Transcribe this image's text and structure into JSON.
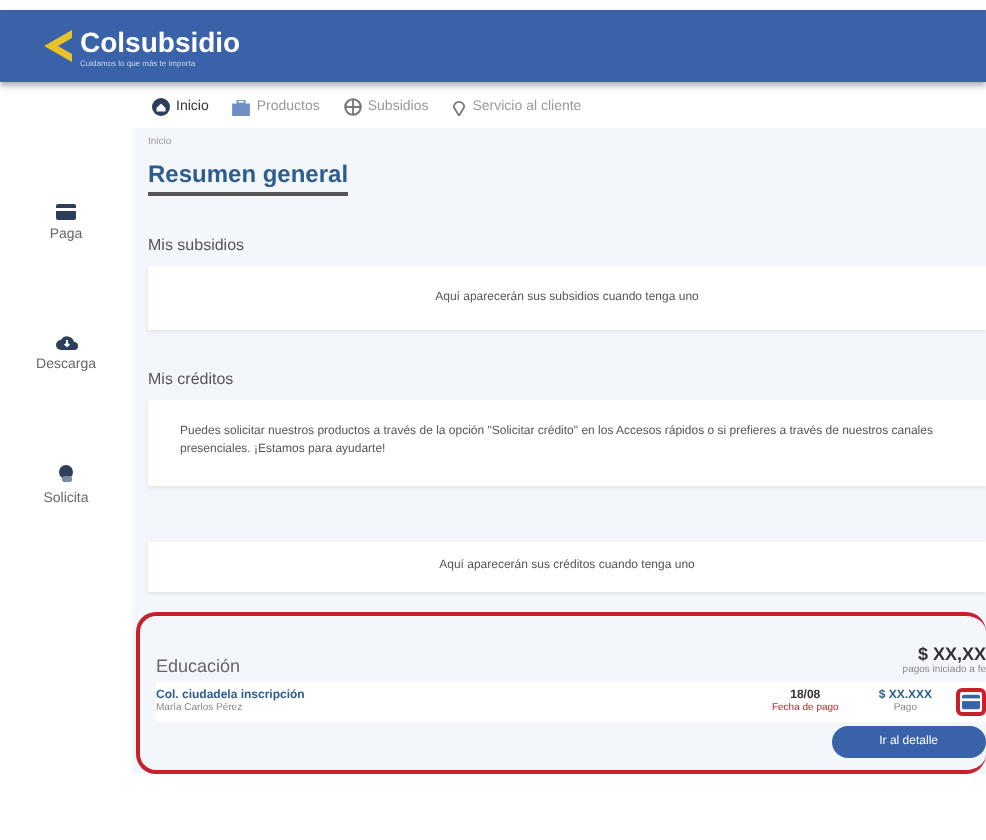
{
  "header": {
    "brand": "Colsubsidio",
    "tagline": "Cuidamos lo que más te importa"
  },
  "nav": [
    {
      "label": "Inicio",
      "selected": true
    },
    {
      "label": "Productos",
      "selected": false
    },
    {
      "label": "Subsidios",
      "selected": false
    },
    {
      "label": "Servicio al cliente",
      "selected": false
    }
  ],
  "sidebar": [
    {
      "label": "Paga"
    },
    {
      "label": "Descarga"
    },
    {
      "label": "Solicita"
    }
  ],
  "breadcrumb": "Inicio",
  "title": "Resumen general",
  "subsidies": {
    "heading": "Mis subsidios",
    "empty": "Aquí aparecerán sus subsidios cuando tenga uno"
  },
  "credits": {
    "heading": "Mis créditos",
    "info": "Puedes solicitar nuestros productos a través de la opción \"Solicitar crédito\" en los Accesos rápidos o si prefieres a través de nuestros canales presenciales. ¡Estamos para ayudarte!",
    "empty": "Aquí aparecerán sus créditos cuando tenga uno"
  },
  "education": {
    "heading": "Educación",
    "total": "$ XX,XX",
    "total_note": "pagos iniciado a fe",
    "item": {
      "name": "Col. ciudadela inscripción",
      "person": "María Carlos Pérez",
      "date": "18/08",
      "date_label": "Fecha de pago",
      "amount": "$ XX.XXX",
      "amount_label": "Pago"
    },
    "button": "Ir al detalle"
  }
}
